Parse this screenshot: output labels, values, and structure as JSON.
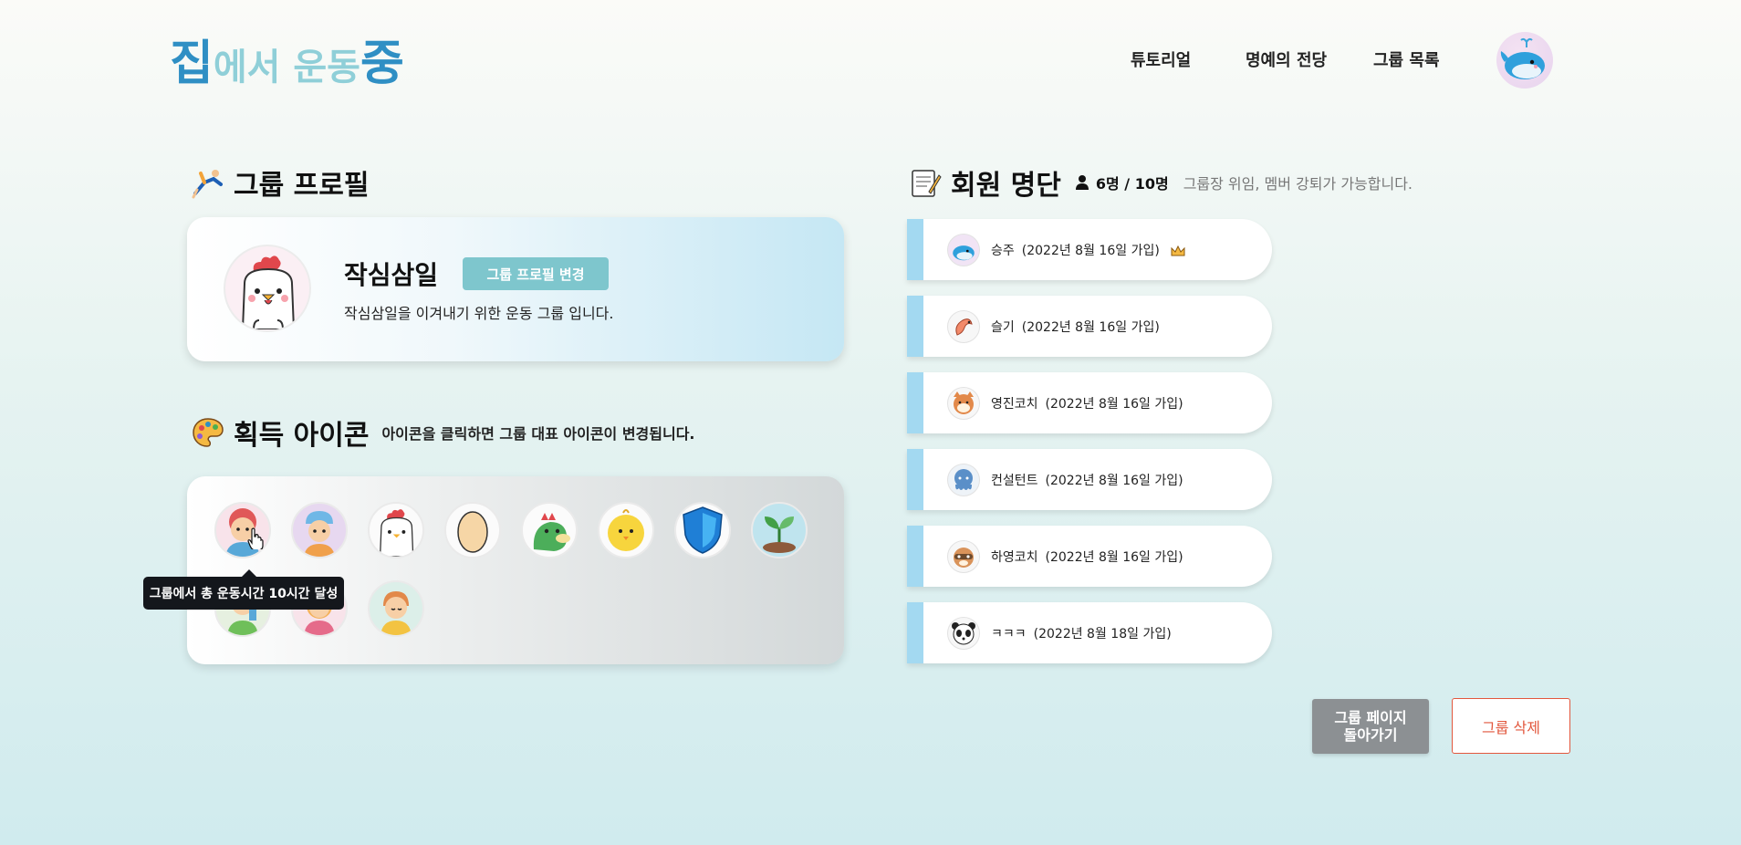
{
  "header": {
    "logo": {
      "part1": "집",
      "part2": "에서 운동",
      "part3": "중"
    },
    "nav": [
      "튜토리얼",
      "명예의 전당",
      "그룹 목록"
    ],
    "avatar_icon": "whale-avatar-icon"
  },
  "profile": {
    "section_title": "그룹 프로필",
    "name": "작심삼일",
    "edit_label": "그룹 프로필 변경",
    "description": "작심삼일을 이겨내기 위한 운동 그룹 입니다.",
    "avatar_icon": "rooster-icon"
  },
  "icons": {
    "section_title": "획득 아이콘",
    "hint": "아이콘을 클릭하면 그룹 대표 아이콘이 변경됩니다.",
    "items": [
      "boy-icon",
      "cap-kid-icon",
      "rooster-icon",
      "egg-icon",
      "dragon-icon",
      "chick-icon",
      "shield-icon",
      "sprout-icon",
      "kid-drink-icon",
      "girl-icon",
      "boy-smile-icon"
    ],
    "tooltip": "그룹에서 총 운동시간 10시간 달성"
  },
  "members": {
    "section_title": "회원 명단",
    "count": "6명 / 10명",
    "hint": "그룹장 위임, 멤버 강퇴가 가능합니다.",
    "list": [
      {
        "name": "승주",
        "date": "(2022년 8월 16일 가입)",
        "icon": "whale-icon",
        "leader": true
      },
      {
        "name": "슬기",
        "date": "(2022년 8월 16일 가입)",
        "icon": "shrimp-icon",
        "leader": false
      },
      {
        "name": "영진코치",
        "date": "(2022년 8월 16일 가입)",
        "icon": "fox-icon",
        "leader": false
      },
      {
        "name": "컨설턴트",
        "date": "(2022년 8월 16일 가입)",
        "icon": "octopus-icon",
        "leader": false
      },
      {
        "name": "하영코치",
        "date": "(2022년 8월 16일 가입)",
        "icon": "raccoon-icon",
        "leader": false
      },
      {
        "name": "ㅋㅋㅋ",
        "date": "(2022년 8월 18일 가입)",
        "icon": "panda-icon",
        "leader": false
      }
    ]
  },
  "actions": {
    "back_label": "그룹 페이지 돌아가기",
    "delete_label": "그룹 삭제"
  },
  "colors": {
    "logo_dark": "#2f8fc4",
    "logo_light": "#8fcfd8",
    "edit_button": "#7ec6cd",
    "member_bar": "#a3d9f1",
    "delete": "#e2573d"
  }
}
